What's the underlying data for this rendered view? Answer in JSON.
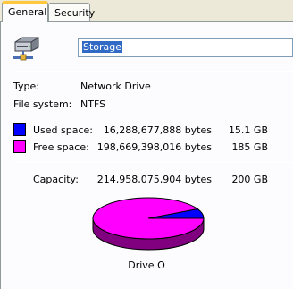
{
  "tabs": [
    {
      "label": "General"
    },
    {
      "label": "Security"
    }
  ],
  "drive": {
    "name": "Storage",
    "type_label": "Type:",
    "type_value": "Network Drive",
    "fs_label": "File system:",
    "fs_value": "NTFS",
    "caption": "Drive O"
  },
  "icons": {
    "drive": "network-drive-icon"
  },
  "colors": {
    "used": "#0000ff",
    "free": "#ff00ff"
  },
  "space": {
    "used": {
      "label": "Used space:",
      "bytes": "16,288,677,888 bytes",
      "size": "15.1 GB"
    },
    "free": {
      "label": "Free space:",
      "bytes": "198,669,398,016 bytes",
      "size": "185 GB"
    },
    "capacity": {
      "label": "Capacity:",
      "bytes": "214,958,075,904 bytes",
      "size": "200 GB"
    }
  },
  "chart_data": {
    "type": "pie",
    "categories": [
      "Used space",
      "Free space"
    ],
    "values": [
      16288677888,
      198669398016
    ],
    "colors": [
      "#0000ff",
      "#ff00ff"
    ]
  }
}
